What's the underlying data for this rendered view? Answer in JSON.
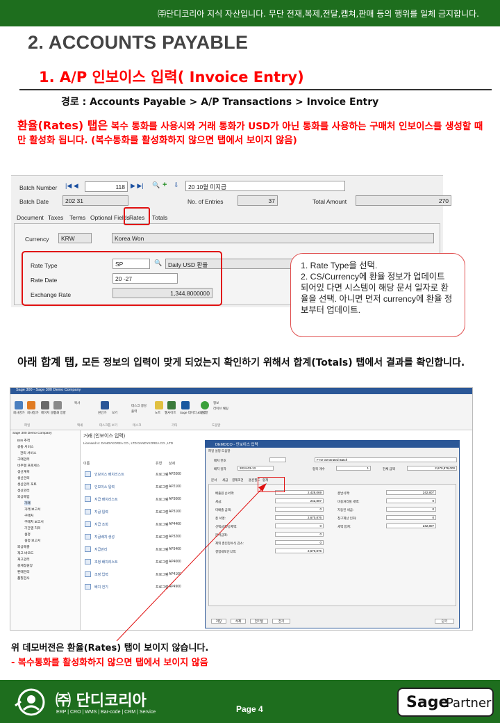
{
  "header": {
    "notice": "㈜단디코리아 지식 자산입니다. 무단 전재,복제,전달,캡쳐,판매  등의 행위를 일체 금지합니다."
  },
  "section_title": "2. ACCOUNTS PAYABLE",
  "subsection_title": "1. A/P 인보이스 입력( Invoice Entry)",
  "path": "경로 : Accounts Payable > A/P Transactions > Invoice Entry",
  "rates_note": {
    "lead": "환율(Rates) 탭은",
    "body": "복수 통화를 사용시와 거래 통화가 USD가 아닌 통화를 사용하는 구매처 인보이스를 생성할 때만 활성화 됩니다. (복수통화를 활성화하지 않으면 탭에서 보이지 않음)"
  },
  "shot1": {
    "batch_number_label": "Batch Number",
    "batch_number_value": "118",
    "batch_desc": "20      10월 미지급",
    "batch_date_label": "Batch Date",
    "batch_date_value": "202    31",
    "entries_label": "No. of Entries",
    "entries_value": "37",
    "total_label": "Total Amount",
    "total_value": "270",
    "tabs": [
      "Document",
      "Taxes",
      "Terms",
      "Optional Fields",
      "Rates",
      "Totals"
    ],
    "currency_label": "Currency",
    "currency_code": "KRW",
    "currency_name": "Korea Won",
    "rate_type_label": "Rate Type",
    "rate_type_value": "SP",
    "rate_type_desc": "Daily USD 환율",
    "rate_date_label": "Rate Date",
    "rate_date_value": "20      -27",
    "exchange_rate_label": "Exchange Rate",
    "exchange_rate_value": "1,344.8000000"
  },
  "callout": {
    "line1": "1. Rate Type을 선택.",
    "line2": "2. CS/Currency에 환율 정보가 업데이트 되어있 다면 시스템이 해당 문서 일자로 환율을 선택. 아니면 먼저 currency에 환율 정보부터 업데이트."
  },
  "totals_note": {
    "lead": "아래 합계 탭,",
    "body": " 모든 정보의 입력이 맞게 되었는지 확인하기 위해서 합계(Totals) 탭에서 결과를 확인합니다."
  },
  "shot2": {
    "window_title": "Sage 300 - Sage 300 Demo Company",
    "ribbon_groups": [
      "파일",
      "액세",
      "데스크톱 보기",
      "테스크",
      "기타",
      "도움말"
    ],
    "ribbon_buttons": [
      "회사명가",
      "회사정가",
      "페이지 설정",
      "인쇄 방향",
      "복사",
      "원인가",
      "보기",
      "테스크 생성",
      "출력",
      "노트",
      "웹사이트",
      "Sage 데이터 & 분석",
      "도움말",
      "정보",
      "라이브 채팅"
    ],
    "sidebar_root": "Sage 300 Demo Company",
    "sidebar_items": [
      "BIN 추적",
      "공통 서비스",
      "관리 서비스",
      "구매관리",
      "비주얼 프로세스",
      "생산계획",
      "생산관리",
      "생산관리 포트",
      "생산관리",
      "외상매입",
      "거래",
      "거래 보고서",
      "구매처",
      "구매처 보고서",
      "기간별 처리",
      "설정",
      "설정 보고서",
      "외상매출",
      "재고 바코드",
      "재고관리",
      "총계정원장",
      "판매관리",
      "품질검사"
    ],
    "main_header": "거래 (인보이스 입력)",
    "company_info": "Licensed to: DANDYKOREA CO., LTD DANDYKOREA CO., LTD",
    "table_headers": [
      "이름",
      "유형",
      "상세"
    ],
    "table_rows": [
      {
        "name": "인보이스 배치리스트",
        "type": "프로그램",
        "code": "AP2000"
      },
      {
        "name": "인보이스 입력",
        "type": "프로그램",
        "code": "AP2100"
      },
      {
        "name": "지급 배치리스트",
        "type": "프로그램",
        "code": "AP3000"
      },
      {
        "name": "지급 입력",
        "type": "프로그램",
        "code": "AP3100"
      },
      {
        "name": "지급 조회",
        "type": "프로그램",
        "code": "AP4400"
      },
      {
        "name": "지급배치 생성",
        "type": "프로그램",
        "code": "AP3200"
      },
      {
        "name": "지급관리",
        "type": "프로그램",
        "code": "AP3400"
      },
      {
        "name": "조정 배치리스트",
        "type": "프로그램",
        "code": "AP4000"
      },
      {
        "name": "조정 입력",
        "type": "프로그램",
        "code": "AP4100"
      },
      {
        "name": "배치 전기",
        "type": "프로그램",
        "code": "AP4900"
      }
    ],
    "dialog": {
      "title": "DEMOCO - 인보이스 입력",
      "menu": "파일  설정  도움말",
      "batch_no_label": "배치 번호",
      "batch_desc": "F-IO Generated Batch",
      "batch_date_label": "배치 일자",
      "batch_date_value": "2024-03-13",
      "entries_label": "항목 개수",
      "entries_value": "1",
      "total_label": "전체 금액",
      "total_value": "2,670,876,000",
      "tabs": [
        "문서",
        "세금",
        "결제조건",
        "옵션필드",
        "합계"
      ],
      "left_labels": [
        "배출원 순서액:",
        "세금:",
        "미배출 금액:",
        "총 서명:",
        "선택금액/공제액:",
        "문서금액:",
        "제외 총인정수식 감소:",
        "결합세포인식액:"
      ],
      "left_values": [
        "2,428,069",
        "242,807",
        "0",
        "2,670,876",
        "0",
        "0",
        "0",
        "2,670,876"
      ],
      "right_labels": [
        "총납식액:",
        "비용처리될 세액:",
        "자동된 세금:",
        "청구계산 인화:",
        "세액 합계:"
      ],
      "right_values": [
        "242,807",
        "0",
        "0",
        "0",
        "242,807"
      ],
      "buttons": [
        "저장",
        "삭제",
        "전기일",
        "전기",
        "닫기"
      ]
    }
  },
  "demo_note": {
    "line1": "위 데모버전은 환율(Rates) 탭이 보이지 않습니다.",
    "line2": "- 복수통화를 활성화하지 않으면 탭에서 보이지 않음"
  },
  "footer": {
    "company": "㈜ 단디코리아",
    "tagline": "ERP | CRO | WMS | Bar-code | CRM | Service",
    "page": "Page  4",
    "partner_sage": "Sage",
    "partner_text": "Partner"
  },
  "colors": {
    "brand_green": "#1e6e1e",
    "highlight_red": "#ff0000",
    "sage_blue": "#2b5797"
  }
}
